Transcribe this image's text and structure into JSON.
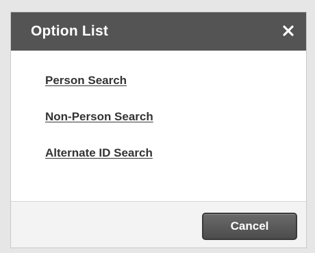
{
  "dialog": {
    "title": "Option List",
    "close_icon": "close-icon"
  },
  "options": [
    {
      "label": "Person Search"
    },
    {
      "label": "Non-Person Search"
    },
    {
      "label": "Alternate ID Search"
    }
  ],
  "footer": {
    "cancel_label": "Cancel"
  },
  "colors": {
    "header_bg": "#545454",
    "header_text": "#ffffff",
    "link_text": "#333333",
    "footer_bg": "#f3f3f3",
    "button_bg": "#555555"
  }
}
